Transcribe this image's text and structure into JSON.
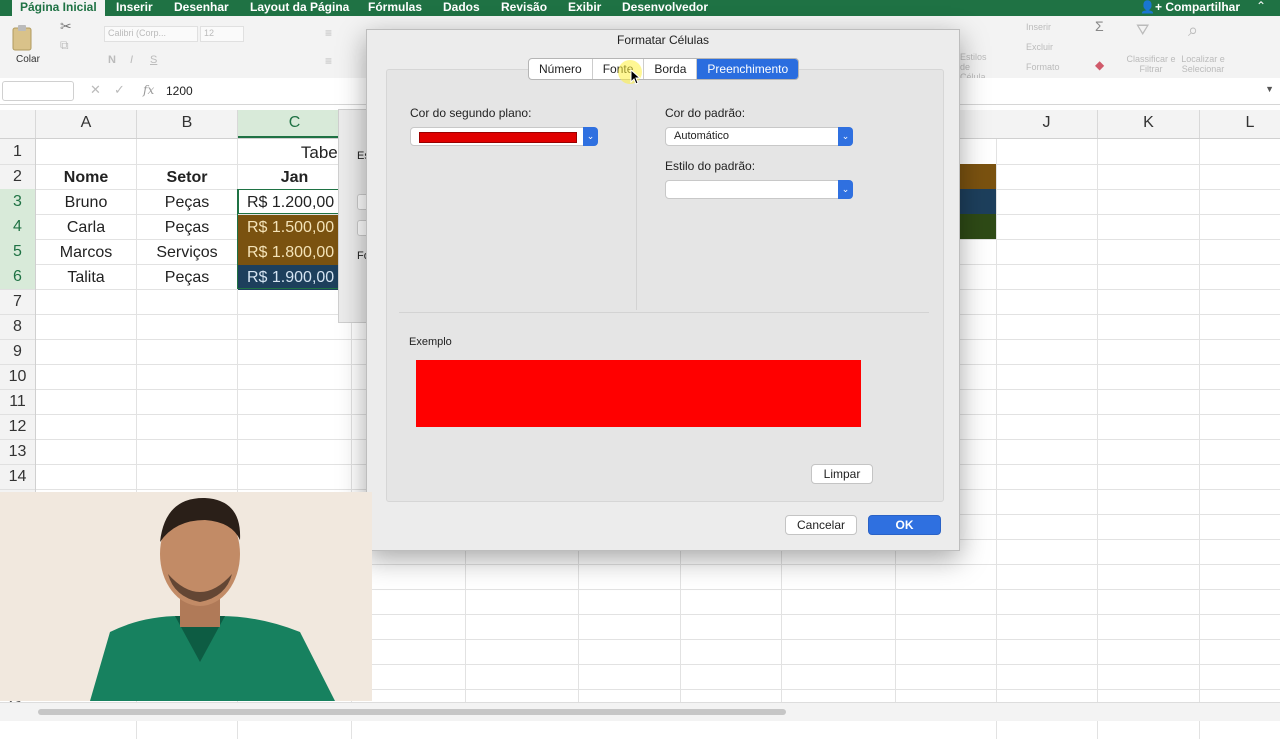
{
  "ribbon_tabs": [
    "Página Inicial",
    "Inserir",
    "Desenhar",
    "Layout da Página",
    "Fórmulas",
    "Dados",
    "Revisão",
    "Exibir",
    "Desenvolvedor"
  ],
  "share_label": "Compartilhar",
  "ribbon": {
    "paste_label": "Colar",
    "font_name": "Calibri (Corp...",
    "font_size": "12",
    "insert_label": "Inserir",
    "delete_label": "Excluir",
    "format_label": "Formato",
    "styles_label": "Estilos de Célula",
    "sort_label": "Classificar e Filtrar",
    "find_label": "Localizar e Selecionar"
  },
  "formula_bar": {
    "fx": "fx",
    "value": "1200"
  },
  "columns": [
    "A",
    "B",
    "C",
    "J",
    "K",
    "L"
  ],
  "rows": [
    "1",
    "2",
    "3",
    "4",
    "5",
    "6",
    "7",
    "8",
    "9",
    "10",
    "11",
    "12",
    "13",
    "14",
    "23"
  ],
  "sheet": {
    "title": "Tabela",
    "headers": [
      "Nome",
      "Setor",
      "Jan"
    ],
    "data": [
      [
        "Bruno",
        "Peças",
        "R$  1.200,00"
      ],
      [
        "Carla",
        "Peças",
        "R$  1.500,00"
      ],
      [
        "Marcos",
        "Serviços",
        "R$  1.800,00"
      ],
      [
        "Talita",
        "Peças",
        "R$  1.900,00"
      ]
    ]
  },
  "bg_dialog": {
    "text1": "Es",
    "text2": "Fo"
  },
  "dialog": {
    "title": "Formatar Células",
    "tabs": [
      "Número",
      "Fonte",
      "Borda",
      "Preenchimento"
    ],
    "active_tab": "Preenchimento",
    "bg_color_label": "Cor do segundo plano:",
    "bg_color_value": "#e00000",
    "pattern_color_label": "Cor do padrão:",
    "pattern_color_value": "Automático",
    "pattern_style_label": "Estilo do padrão:",
    "sample_label": "Exemplo",
    "sample_color": "#ff0000",
    "clear_button": "Limpar",
    "cancel_button": "Cancelar",
    "ok_button": "OK"
  },
  "colors": {
    "excel_green": "#1f7244",
    "cell_brown": "#7a5210",
    "cell_navy": "#1d3f5c",
    "cell_dark_green": "#2e4a16",
    "accent_blue": "#2f70e0"
  }
}
